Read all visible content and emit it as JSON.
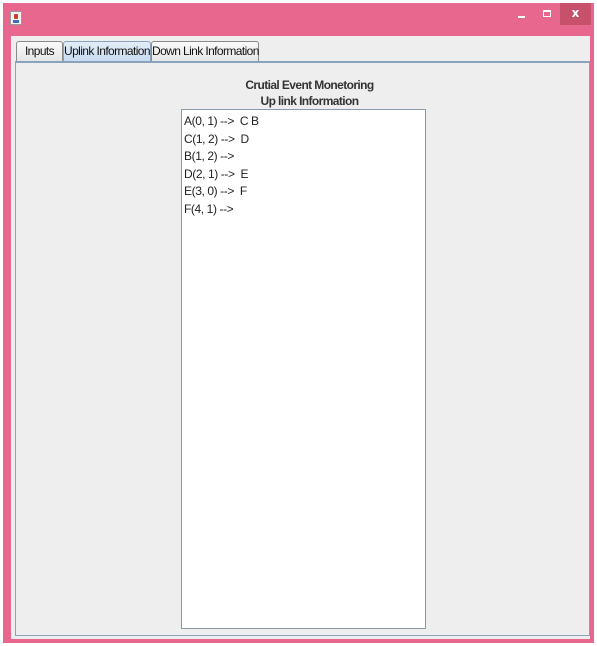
{
  "window": {
    "title": "",
    "controls": {
      "minimize": "",
      "maximize": "",
      "close": "x"
    },
    "accent_color": "#e8678f"
  },
  "tabs": [
    {
      "label": "Inputs",
      "selected": false
    },
    {
      "label": "Uplink Information",
      "selected": true
    },
    {
      "label": "Down Link Information",
      "selected": false
    }
  ],
  "panel": {
    "title_line1": "Crutial Event Monetoring",
    "title_line2": "Up link Information",
    "text_lines": [
      "A(0, 1) -->  C B",
      "C(1, 2) -->  D",
      "B(1, 2) -->",
      "D(2, 1) -->  E",
      "E(3, 0) -->  F",
      "F(4, 1) -->"
    ]
  }
}
